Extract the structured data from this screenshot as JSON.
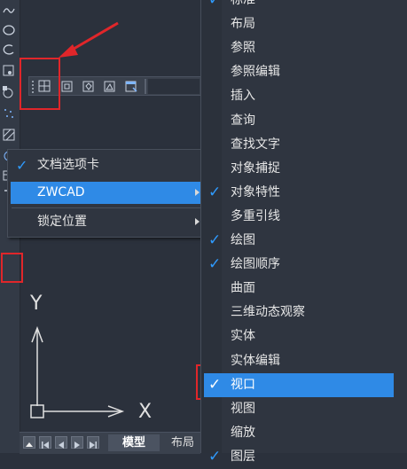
{
  "context_menu": {
    "items": [
      {
        "label": "文档选项卡",
        "checked": true
      },
      {
        "label": "ZWCAD",
        "has_submenu": true,
        "highlighted": true
      },
      {
        "label": "锁定位置",
        "has_submenu": true
      }
    ]
  },
  "toolbar_menu": {
    "items": [
      {
        "label": "标准",
        "checked": true
      },
      {
        "label": "布局",
        "checked": false
      },
      {
        "label": "参照",
        "checked": false
      },
      {
        "label": "参照编辑",
        "checked": false
      },
      {
        "label": "插入",
        "checked": false
      },
      {
        "label": "查询",
        "checked": false
      },
      {
        "label": "查找文字",
        "checked": false
      },
      {
        "label": "对象捕捉",
        "checked": false
      },
      {
        "label": "对象特性",
        "checked": true
      },
      {
        "label": "多重引线",
        "checked": false
      },
      {
        "label": "绘图",
        "checked": true
      },
      {
        "label": "绘图顺序",
        "checked": true
      },
      {
        "label": "曲面",
        "checked": false
      },
      {
        "label": "三维动态观察",
        "checked": false
      },
      {
        "label": "实体",
        "checked": false
      },
      {
        "label": "实体编辑",
        "checked": false
      },
      {
        "label": "视口",
        "checked": true,
        "highlighted": true
      },
      {
        "label": "视图",
        "checked": false
      },
      {
        "label": "缩放",
        "checked": false
      },
      {
        "label": "图层",
        "checked": true
      }
    ]
  },
  "ucs": {
    "y_label": "Y",
    "x_label": "X"
  },
  "bottom_tabs": {
    "model": "模型",
    "layout": "布局"
  },
  "colors": {
    "accent": "#2f8ae6",
    "annotation": "#e0262a",
    "check": "#2f9bff"
  }
}
